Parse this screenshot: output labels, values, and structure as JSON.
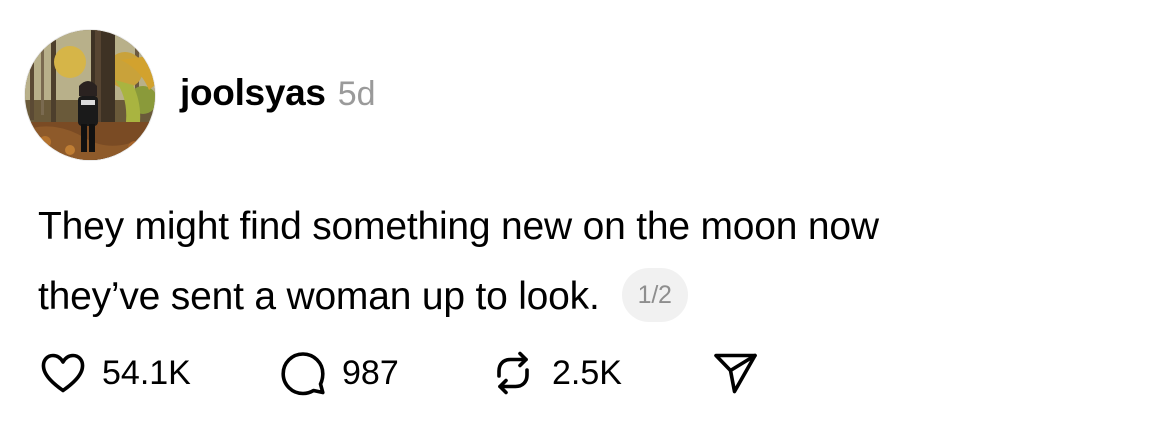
{
  "post": {
    "username": "joolsyas",
    "time_ago": "5d",
    "text_line1": "They might find something new on the moon now",
    "text_line2": "they’ve sent a woman up to look.",
    "page_indicator": "1/2"
  },
  "actions": {
    "likes": "54.1K",
    "replies": "987",
    "reposts": "2.5K"
  },
  "icons": {
    "like": "heart-icon",
    "reply": "speech-bubble-icon",
    "repost": "repost-arrows-icon",
    "share": "paper-plane-icon"
  },
  "colors": {
    "text": "#000000",
    "secondary": "#9a9a9a",
    "badge_bg": "#f1f1f1"
  }
}
